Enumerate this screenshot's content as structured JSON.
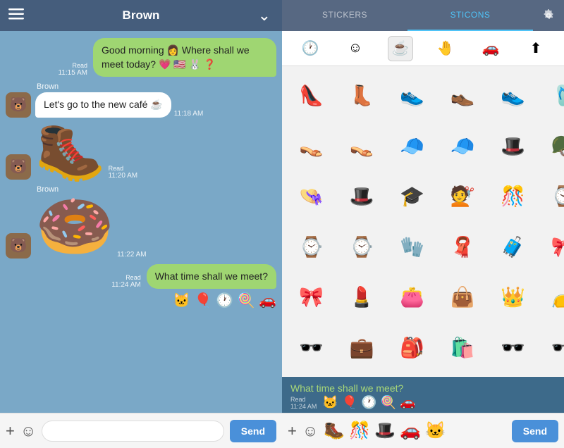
{
  "header": {
    "title": "Brown",
    "hamburger": "☰",
    "chevron": "⌄"
  },
  "tabs": {
    "stickers_label": "STICKERS",
    "sticons_label": "STICONS"
  },
  "messages": [
    {
      "id": "msg1",
      "type": "outgoing",
      "text": "Good morning 👩 Where shall we meet today? 💗 🇺🇸 🐰 ❓",
      "time": "11:15 AM",
      "read": "Read"
    },
    {
      "id": "msg2",
      "type": "incoming",
      "sender": "Brown",
      "text": "Let's go to the new café ☕",
      "time": "11:18 AM",
      "read": ""
    },
    {
      "id": "msg3",
      "type": "incoming",
      "sender": "Brown",
      "sticker": "🥾",
      "time": "11:20 AM",
      "read": "Read"
    },
    {
      "id": "msg4",
      "type": "incoming",
      "sender": "Brown",
      "sticker": "🍩",
      "time": "11:22 AM",
      "read": ""
    },
    {
      "id": "msg5",
      "type": "outgoing",
      "text": "What time shall we meet?",
      "time": "11:24 AM",
      "read": "Read",
      "icons": "🐱 🎈 🕐 🍭 🚗"
    }
  ],
  "input": {
    "placeholder": "",
    "send_label": "Send",
    "plus": "+",
    "emoji": "☺"
  },
  "sticker_categories": [
    "🕐",
    "☺",
    "☕",
    "🤚",
    "🚗",
    "⬆"
  ],
  "stickers": [
    "👠",
    "👢",
    "👟",
    "👞",
    "👟",
    "🩴",
    "👡",
    "👡",
    "🧢",
    "🧢",
    "🎩",
    "🪖",
    "👒",
    "🎩",
    "🎓",
    "💇",
    "🎊",
    "⌚",
    "⌚",
    "⌚",
    "🧤",
    "🧣",
    "🧳",
    "🎀",
    "🎀",
    "💄",
    "👛",
    "👜",
    "👑",
    "👝",
    "🕶",
    "💼",
    "🎒",
    "🛍",
    "🕶",
    "🕶"
  ],
  "preview": {
    "text": "What time shall we meet?",
    "time": "11:24 AM",
    "read": "Read",
    "icons": "🐱 🎈 🕐 🍭 🚗",
    "sticker_previews": [
      "🥾",
      "🎊",
      "🎩",
      "🚗",
      "🐱"
    ]
  },
  "colors": {
    "accent": "#4a90d9",
    "active_tab": "#4fc3f7",
    "chat_bg": "#7aa8c7",
    "outgoing_bubble": "#9fd672",
    "send_btn": "#4a90d9"
  }
}
